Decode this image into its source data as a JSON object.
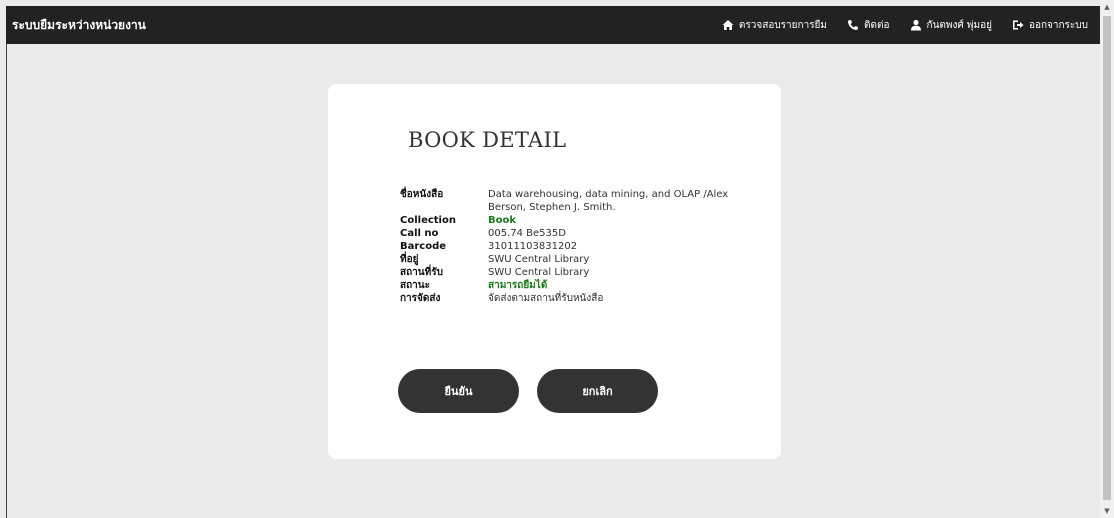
{
  "navbar": {
    "brand": "ระบบยืมระหว่างหน่วยงาน",
    "links": [
      {
        "icon": "home-icon",
        "label": "ตรวจสอบรายการยืม"
      },
      {
        "icon": "phone-icon",
        "label": "ติดต่อ"
      },
      {
        "icon": "user-icon",
        "label": "กันตพงศ์ พุ่มอยู่"
      },
      {
        "icon": "logout-icon",
        "label": "ออกจากระบบ"
      }
    ]
  },
  "card": {
    "title": "BOOK DETAIL",
    "details": [
      {
        "label": "ชื่อหนังสือ",
        "value": "Data warehousing, data mining, and OLAP /Alex Berson, Stephen J. Smith."
      },
      {
        "label": "Collection",
        "value": "Book"
      },
      {
        "label": "Call no",
        "value": "005.74 Be535D"
      },
      {
        "label": "Barcode",
        "value": "31011103831202"
      },
      {
        "label": "ที่อยู่",
        "value": "SWU Central Library"
      },
      {
        "label": "สถานที่รับ",
        "value": "SWU Central Library"
      },
      {
        "label": "สถานะ",
        "value": "สามารถยืมได้"
      },
      {
        "label": "การจัดส่ง",
        "value": "จัดส่งตามสถานที่รับหนังสือ"
      }
    ],
    "confirm_label": "ยืนยัน",
    "cancel_label": "ยกเลิก"
  },
  "colors": {
    "navbar": "#222222",
    "button": "#333333",
    "status_green": "#1a7a1a"
  }
}
